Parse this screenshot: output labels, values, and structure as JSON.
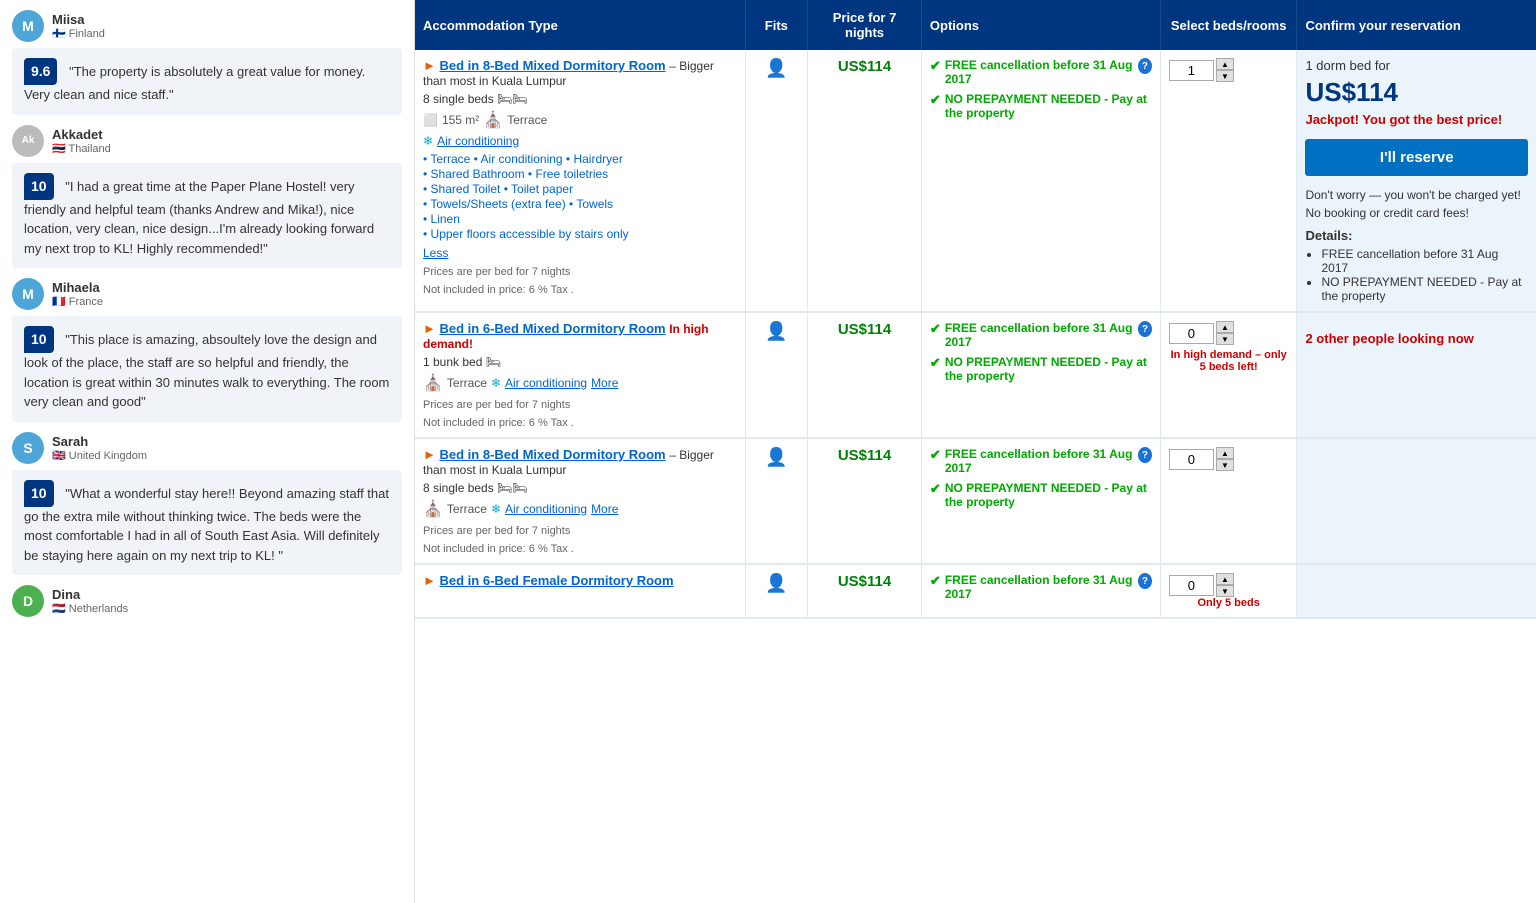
{
  "reviews": [
    {
      "id": "miisa",
      "name": "Miisa",
      "country": "Finland",
      "flag": "🇫🇮",
      "avatar_letter": "M",
      "avatar_color": "#4da6d7",
      "score": null,
      "text": null
    },
    {
      "id": "review1",
      "score": "9.6",
      "text": "\"The property is absolutely a great value for money. Very clean and nice staff.\""
    },
    {
      "id": "akkadet",
      "name": "Akkadet",
      "country": "Thailand",
      "flag": "🇹🇭",
      "avatar_letter": "A",
      "avatar_color": "#888",
      "avatar_img": true,
      "score": null,
      "text": null
    },
    {
      "id": "review2",
      "score": "10",
      "text": "\"I had a great time at the Paper Plane Hostel! very friendly and helpful team (thanks Andrew and Mika!), nice location, very clean, nice design...I'm already looking forward my next trop to KL! Highly recommended!\""
    },
    {
      "id": "mihaela",
      "name": "Mihaela",
      "country": "France",
      "flag": "🇫🇷",
      "avatar_letter": "M",
      "avatar_color": "#4da6d7",
      "score": null,
      "text": null
    },
    {
      "id": "review3",
      "score": "10",
      "text": "\"This place is amazing, absoultely love the design and look of the place, the staff are so helpful and friendly, the location is great within 30 minutes walk to everything. The room very clean and good\""
    },
    {
      "id": "sarah",
      "name": "Sarah",
      "country": "United Kingdom",
      "flag": "🇬🇧",
      "avatar_letter": "S",
      "avatar_color": "#4da6d7",
      "score": null,
      "text": null
    },
    {
      "id": "review4",
      "score": "10",
      "text": "\"What a wonderful stay here!! Beyond amazing staff that go the extra mile without thinking twice. The beds were the most comfortable I had in all of South East Asia. Will definitely be staying here again on my next trip to KL! \""
    },
    {
      "id": "dina",
      "name": "Dina",
      "country": "Netherlands",
      "flag": "🇳🇱",
      "avatar_letter": "D",
      "avatar_color": "#4CAF50",
      "score": null,
      "text": null
    }
  ],
  "table": {
    "headers": {
      "type": "Accommodation Type",
      "fits": "Fits",
      "price": "Price for 7 nights",
      "options": "Options",
      "select": "Select beds/rooms",
      "confirm": "Confirm your reservation"
    },
    "rooms": [
      {
        "id": "room1",
        "title_prefix": "",
        "title": "Bed in 8-Bed Mixed Dormitory Room",
        "title_suffix": " – Bigger than most in Kuala Lumpur",
        "high_demand": false,
        "beds": "8 single beds 🛏🛏",
        "size": "155 m²",
        "terrace": "Terrace",
        "air_conditioning": "Air conditioning",
        "amenities": [
          "Terrace • Air conditioning • Hairdryer",
          "Shared Bathroom • Free toiletries",
          "Shared Toilet • Toilet paper",
          "Towels/Sheets (extra fee) • Towels",
          "Linen",
          "Upper floors accessible by stairs only"
        ],
        "show_less": true,
        "show_more": false,
        "price_note1": "Prices are per bed for 7 nights",
        "price_note2": "Not included in price: 6 % Tax .",
        "price": "US$114",
        "options": [
          "FREE cancellation before 31 Aug 2017",
          "NO PREPAYMENT NEEDED - Pay at the property"
        ],
        "quantity": "1",
        "less_label": "Less",
        "confirm": {
          "summary": "1 dorm bed for",
          "price": "US$114",
          "best_price_msg": "Jackpot! You got the best price!",
          "reserve_btn": "I'll reserve",
          "no_charge": "Don't worry — you won't be charged yet!",
          "no_fees": "No booking or credit card fees!",
          "details_label": "Details:",
          "details": [
            "FREE cancellation before 31 Aug 2017",
            "NO PREPAYMENT NEEDED - Pay at the property"
          ]
        }
      },
      {
        "id": "room2",
        "title": "Bed in 6-Bed Mixed Dormitory Room",
        "title_suffix": "",
        "high_demand": true,
        "high_demand_text": "In high demand!",
        "beds": "1 bunk bed 🛏",
        "size": null,
        "terrace": "Terrace",
        "air_conditioning": "Air conditioning",
        "amenities": [],
        "show_less": false,
        "show_more": true,
        "more_label": "More",
        "price_note1": "Prices are per bed for 7 nights",
        "price_note2": "Not included in price: 6 % Tax .",
        "price": "US$114",
        "options": [
          "FREE cancellation before 31 Aug 2017",
          "NO PREPAYMENT NEEDED - Pay at the property"
        ],
        "quantity": "0",
        "demand_note": "In high demand – only 5 beds left!",
        "confirm": {
          "looking_now": "2 other people looking now"
        }
      },
      {
        "id": "room3",
        "title": "Bed in 8-Bed Mixed Dormitory Room",
        "title_suffix": " – Bigger than most in Kuala Lumpur",
        "high_demand": false,
        "beds": "8 single beds 🛏🛏",
        "size": null,
        "terrace": "Terrace",
        "air_conditioning": "Air conditioning",
        "amenities": [],
        "show_less": false,
        "show_more": true,
        "more_label": "More",
        "price_note1": "Prices are per bed for 7 nights",
        "price_note2": "Not included in price: 6 % Tax .",
        "price": "US$114",
        "options": [
          "FREE cancellation before 31 Aug 2017",
          "NO PREPAYMENT NEEDED - Pay at the property"
        ],
        "quantity": "0",
        "confirm": {}
      },
      {
        "id": "room4",
        "title": "Bed in 6-Bed Female Dormitory Room",
        "title_suffix": "",
        "high_demand": false,
        "beds": "",
        "size": null,
        "terrace": null,
        "air_conditioning": null,
        "amenities": [],
        "show_less": false,
        "show_more": false,
        "price_note1": "",
        "price_note2": "",
        "price": "US$114",
        "options": [
          "FREE cancellation before 31 Aug 2017"
        ],
        "quantity": "0",
        "demand_note": "Only 5 beds",
        "confirm": {}
      }
    ]
  }
}
